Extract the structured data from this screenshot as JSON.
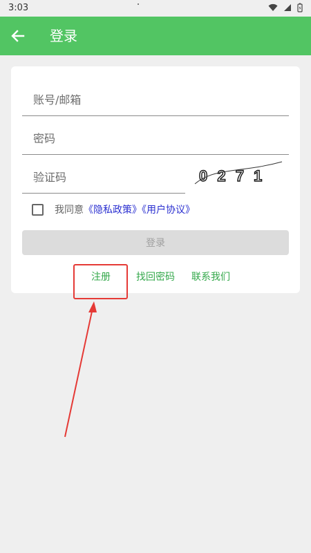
{
  "status_bar": {
    "time": "3:03"
  },
  "app_bar": {
    "title": "登录"
  },
  "form": {
    "account_placeholder": "账号/邮箱",
    "password_placeholder": "密码",
    "captcha_placeholder": "验证码",
    "captcha_text": "0 2 7 1"
  },
  "agreement": {
    "prefix": "我同意",
    "privacy_link": "《隐私政策》",
    "user_link": "《用户协议》"
  },
  "login_button": "登录",
  "links": {
    "register": "注册",
    "forgot_password": "找回密码",
    "contact_us": "联系我们"
  },
  "colors": {
    "app_bar": "#52c563",
    "link_green": "#33a84a",
    "link_blue": "#2a2fd0",
    "annotation_red": "#e53935"
  }
}
